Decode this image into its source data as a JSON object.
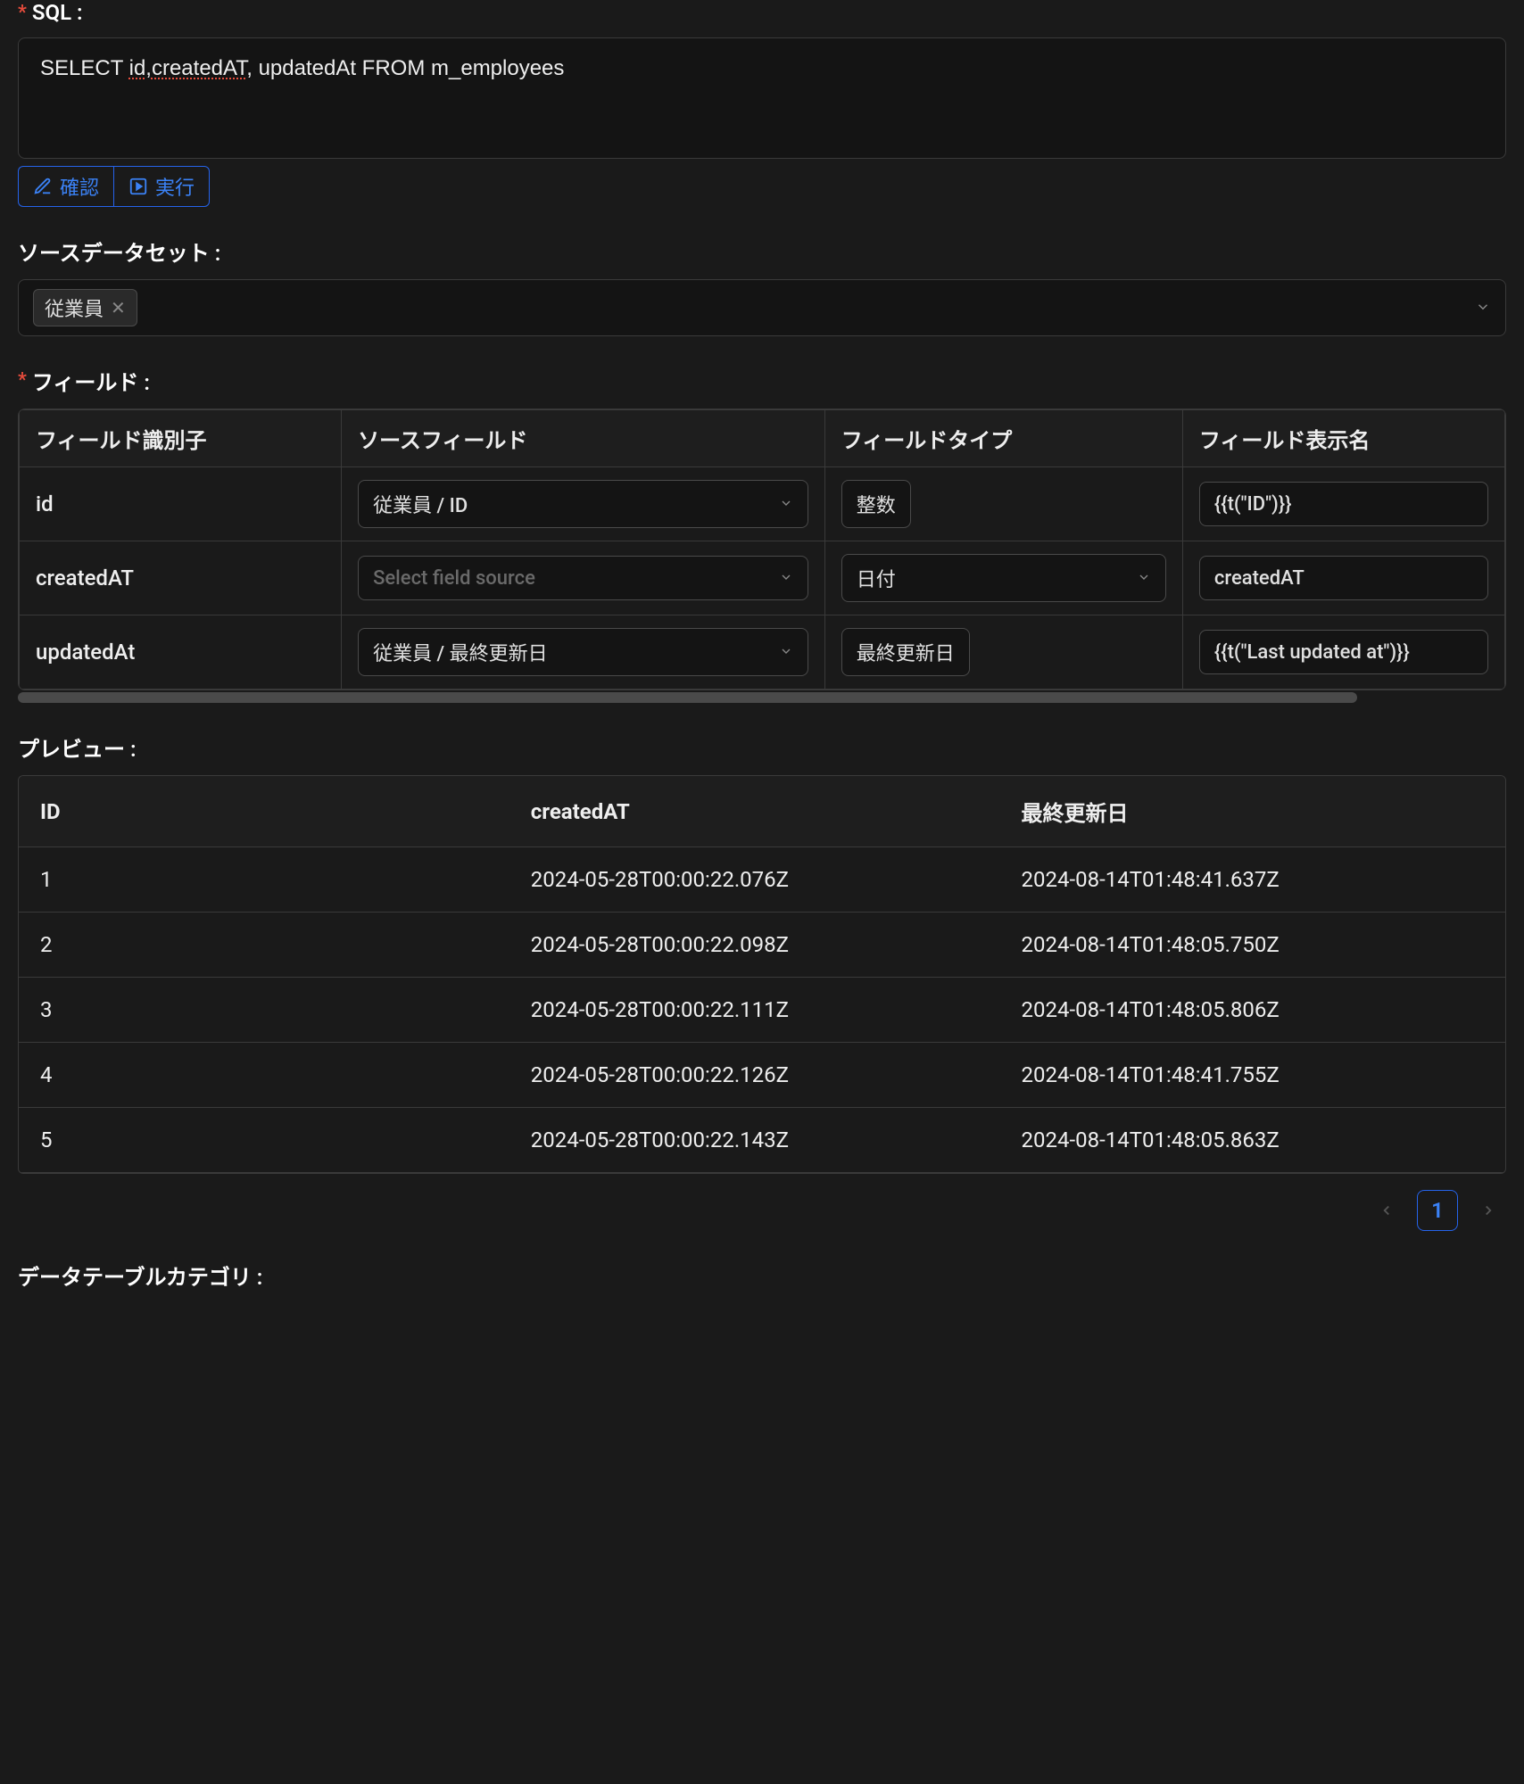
{
  "sql_section": {
    "label": "SQL :",
    "value_parts": [
      "SELECT ",
      "id",
      ",",
      "createdAT",
      ", updatedAt FROM m_employees"
    ],
    "btn_confirm": "確認",
    "btn_execute": "実行"
  },
  "source_dataset": {
    "label": "ソースデータセット :",
    "tag": "従業員"
  },
  "fields_section": {
    "label": "フィールド :",
    "columns": [
      "フィールド識別子",
      "ソースフィールド",
      "フィールドタイプ",
      "フィールド表示名"
    ],
    "rows": [
      {
        "identifier": "id",
        "source": "従業員 / ID",
        "source_placeholder": false,
        "type": "整数",
        "type_is_tag": true,
        "display": "{{t(\"ID\")}}"
      },
      {
        "identifier": "createdAT",
        "source": "Select field source",
        "source_placeholder": true,
        "type": "日付",
        "type_is_tag": false,
        "display": "createdAT"
      },
      {
        "identifier": "updatedAt",
        "source": "従業員 / 最終更新日",
        "source_placeholder": false,
        "type": "最終更新日",
        "type_is_tag": true,
        "display": "{{t(\"Last updated at\")}}"
      }
    ]
  },
  "preview_section": {
    "label": "プレビュー :",
    "columns": [
      "ID",
      "createdAT",
      "最終更新日"
    ],
    "rows": [
      [
        "1",
        "2024-05-28T00:00:22.076Z",
        "2024-08-14T01:48:41.637Z"
      ],
      [
        "2",
        "2024-05-28T00:00:22.098Z",
        "2024-08-14T01:48:05.750Z"
      ],
      [
        "3",
        "2024-05-28T00:00:22.111Z",
        "2024-08-14T01:48:05.806Z"
      ],
      [
        "4",
        "2024-05-28T00:00:22.126Z",
        "2024-08-14T01:48:41.755Z"
      ],
      [
        "5",
        "2024-05-28T00:00:22.143Z",
        "2024-08-14T01:48:05.863Z"
      ]
    ],
    "page_current": "1"
  },
  "category_section": {
    "label": "データテーブルカテゴリ :"
  }
}
